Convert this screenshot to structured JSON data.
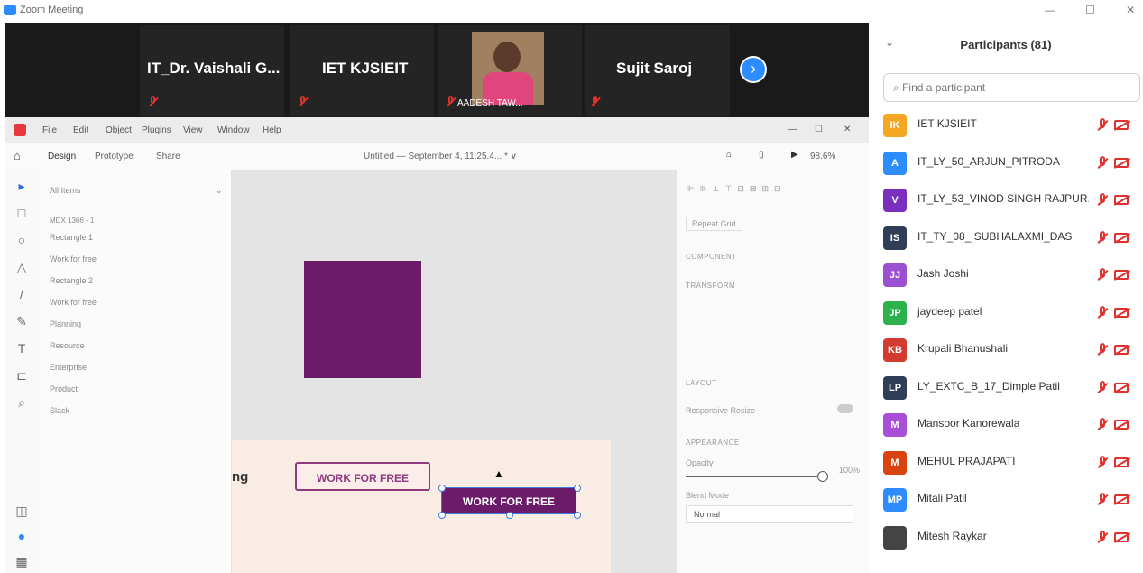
{
  "window": {
    "title": "Zoom Meeting"
  },
  "strip": {
    "tiles": [
      {
        "name": "IT_Dr. Vaishali G..."
      },
      {
        "name": "IET KJSIEIT"
      },
      {
        "name": "AADESH TAW..."
      },
      {
        "name": "Sujit Saroj"
      }
    ],
    "next_icon": "chevron-right-icon"
  },
  "xd": {
    "menu": [
      "File",
      "Edit",
      "Object",
      "Plugins",
      "View",
      "Window",
      "Help"
    ],
    "tabs": [
      "Design",
      "Prototype",
      "Share"
    ],
    "doc_title": "Untitled — September 4, 11.25.4... * ∨",
    "zoom": "98.6%",
    "layers_filter": "All Items",
    "artboard_name": "MDX 1366 - 1",
    "layers": [
      "Rectangle 1",
      "Work for free",
      "Rectangle 2",
      "Work for free",
      "Planning",
      "Resource",
      "Enterprise",
      "Product",
      "Slack"
    ],
    "canvas_text_fragment": "ng",
    "button1": "WORK FOR FREE",
    "button2": "WORK FOR FREE",
    "right": {
      "repeat_grid": "Repeat Grid",
      "component": "COMPONENT",
      "transform": "TRANSFORM",
      "layout": "LAYOUT",
      "responsive": "Responsive Resize",
      "appearance": "APPEARANCE",
      "opacity": "Opacity",
      "opacity_value": "100%",
      "blend_mode": "Blend Mode",
      "blend_value": "Normal"
    }
  },
  "participants": {
    "title": "Participants (81)",
    "search_placeholder": "Find a participant",
    "list": [
      {
        "initials": "IK",
        "name": "IET KJSIEIT",
        "color": "#f5a623"
      },
      {
        "initials": "A",
        "name": "IT_LY_50_ARJUN_PITRODA",
        "color": "#2d8cff"
      },
      {
        "initials": "V",
        "name": "IT_LY_53_VINOD SINGH RAJPUR...",
        "color": "#7b2fbe"
      },
      {
        "initials": "IS",
        "name": "IT_TY_08_ SUBHALAXMI_DAS",
        "color": "#2f3e56"
      },
      {
        "initials": "JJ",
        "name": "Jash Joshi",
        "color": "#9b4fd1"
      },
      {
        "initials": "JP",
        "name": "jaydeep patel",
        "color": "#2bb24c"
      },
      {
        "initials": "KB",
        "name": "Krupali Bhanushali",
        "color": "#d23b2f"
      },
      {
        "initials": "LP",
        "name": "LY_EXTC_B_17_Dimple Patil",
        "color": "#2f3e56"
      },
      {
        "initials": "M",
        "name": "Mansoor Kanorewala",
        "color": "#a94ed6"
      },
      {
        "initials": "M",
        "name": "MEHUL PRAJAPATI",
        "color": "#d8430f"
      },
      {
        "initials": "MP",
        "name": "Mitali Patil",
        "color": "#2d8cff"
      },
      {
        "initials": "",
        "name": "Mitesh Raykar",
        "color": "#444444"
      }
    ]
  }
}
